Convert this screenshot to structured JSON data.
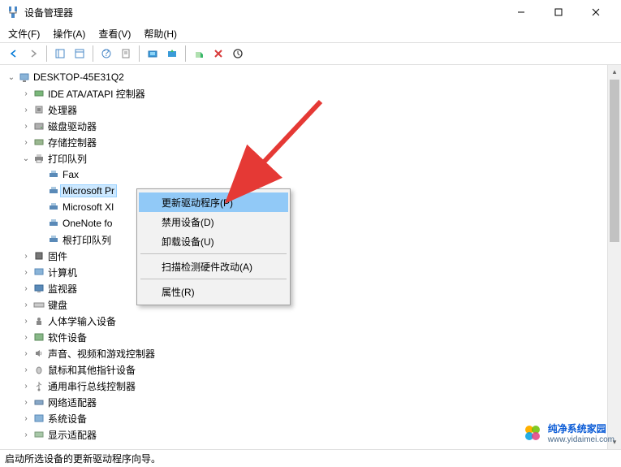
{
  "window": {
    "title": "设备管理器"
  },
  "menubar": {
    "file": "文件(F)",
    "action": "操作(A)",
    "view": "查看(V)",
    "help": "帮助(H)"
  },
  "tree": {
    "root": "DESKTOP-45E31Q2",
    "ide": "IDE ATA/ATAPI 控制器",
    "cpu": "处理器",
    "disk": "磁盘驱动器",
    "storage": "存储控制器",
    "printqueue": "打印队列",
    "pq_fax": "Fax",
    "pq_msprint": "Microsoft Pr",
    "pq_msxps": "Microsoft XI",
    "pq_onenote": "OneNote fo",
    "pq_root": "根打印队列",
    "firmware": "固件",
    "computer": "计算机",
    "monitor": "监视器",
    "keyboard": "键盘",
    "hid": "人体学输入设备",
    "software": "软件设备",
    "audio": "声音、视频和游戏控制器",
    "mouse": "鼠标和其他指针设备",
    "usb": "通用串行总线控制器",
    "network": "网络适配器",
    "system": "系统设备",
    "display": "显示适配器"
  },
  "context_menu": {
    "update_driver": "更新驱动程序(P)",
    "disable": "禁用设备(D)",
    "uninstall": "卸载设备(U)",
    "scan": "扫描检测硬件改动(A)",
    "properties": "属性(R)"
  },
  "statusbar": {
    "text": "启动所选设备的更新驱动程序向导。"
  },
  "watermark": {
    "line1": "纯净系统家园",
    "line2": "www.yidaimei.com"
  }
}
